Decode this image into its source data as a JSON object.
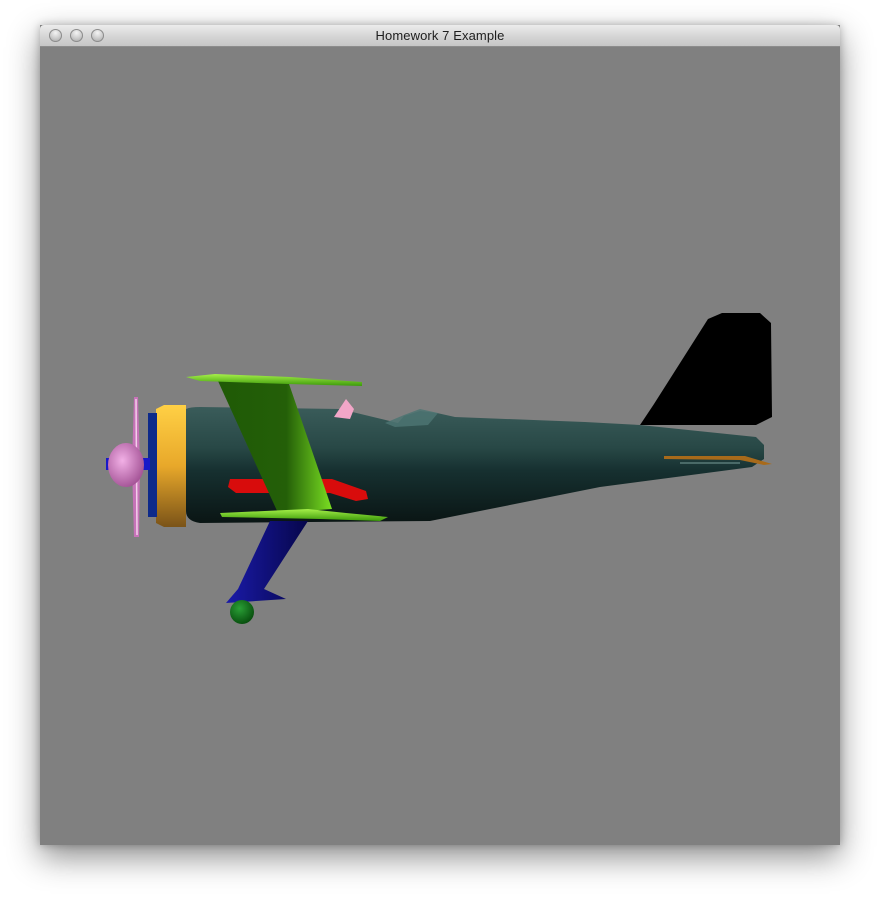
{
  "window": {
    "title": "Homework 7 Example",
    "buttons": [
      "close",
      "minimize",
      "zoom"
    ]
  },
  "scene": {
    "background_color": "#808080",
    "object": "biplane",
    "parts": [
      {
        "name": "fuselage",
        "color": "#1f3b3a"
      },
      {
        "name": "tail-fin",
        "color": "#000000"
      },
      {
        "name": "upper-wing",
        "color": "#6fdc1a"
      },
      {
        "name": "wing-strut",
        "color": "#2a6a08"
      },
      {
        "name": "lower-wing",
        "color": "#5ed610"
      },
      {
        "name": "engine-cowling",
        "color": "#f2b733"
      },
      {
        "name": "propeller",
        "color": "#c673b8"
      },
      {
        "name": "propeller-hub",
        "color": "#d27ac4"
      },
      {
        "name": "exhaust-pipe",
        "color": "#e01010"
      },
      {
        "name": "landing-gear-strut",
        "color": "#0c0c7a"
      },
      {
        "name": "wheel",
        "color": "#0a6a12"
      },
      {
        "name": "pilot-head",
        "color": "#f2a6c8"
      },
      {
        "name": "tail-stabilizer",
        "color": "#a86a1a"
      },
      {
        "name": "axle",
        "color": "#1818c8"
      }
    ]
  }
}
